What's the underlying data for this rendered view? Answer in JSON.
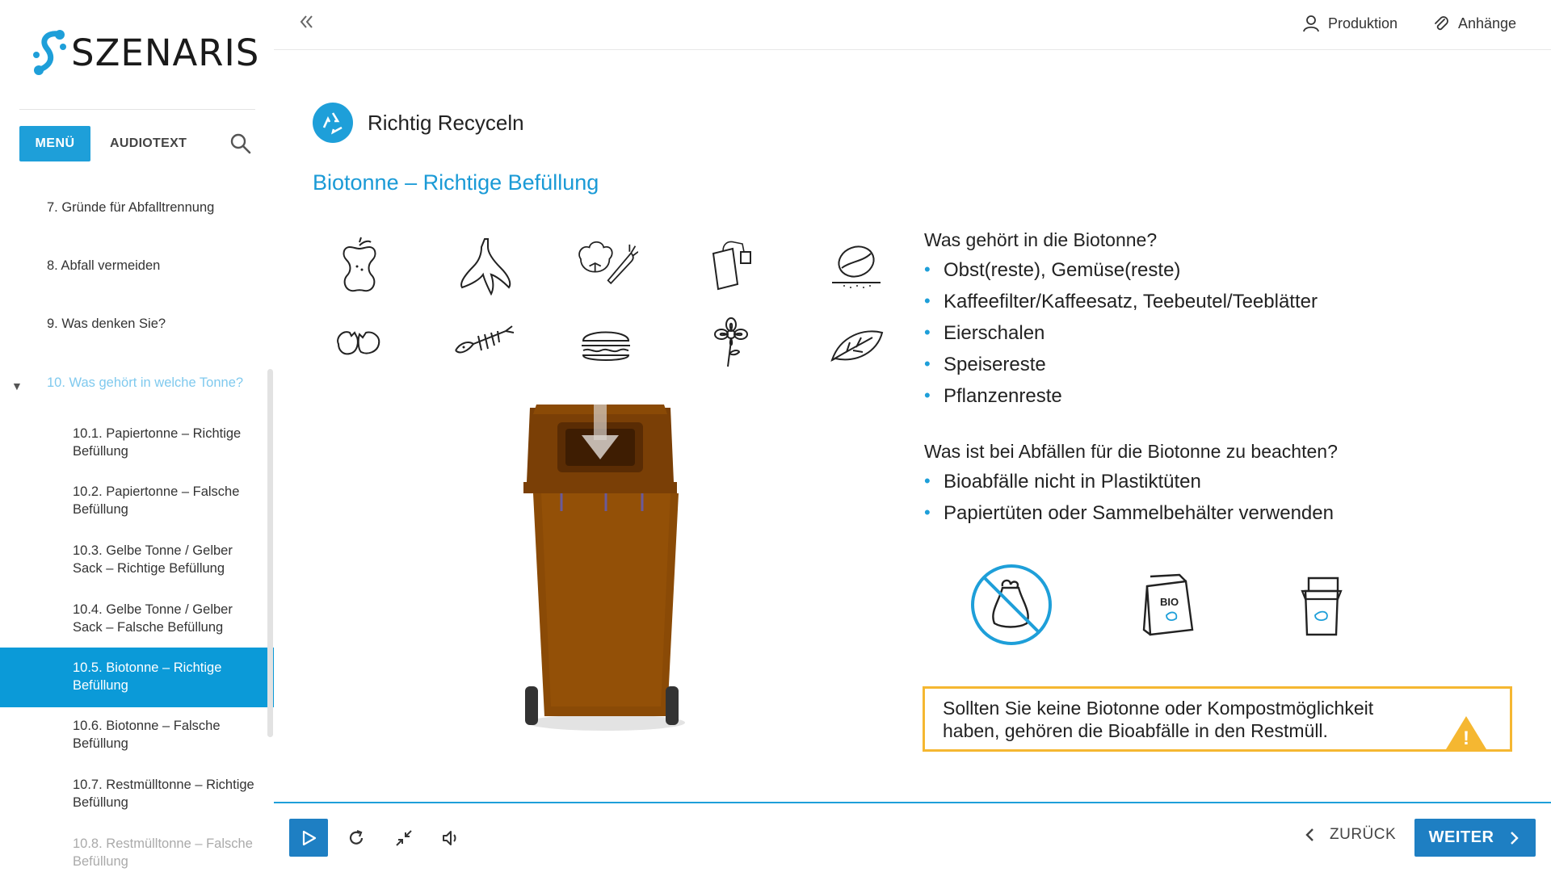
{
  "brand": {
    "name": "SZENARIS"
  },
  "sidebar": {
    "menu_label": "MENÜ",
    "audiotext_label": "AUDIOTEXT",
    "items": [
      {
        "label": "7. Gründe für Abfalltrennung"
      },
      {
        "label": "8. Abfall vermeiden"
      },
      {
        "label": "9. Was denken Sie?"
      },
      {
        "label": "10. Was gehört in welche Tonne?"
      },
      {
        "label": "10.1. Papiertonne – Richtige Befüllung"
      },
      {
        "label": "10.2. Papiertonne – Falsche Befüllung"
      },
      {
        "label": "10.3. Gelbe Tonne / Gelber Sack – Richtige Befüllung"
      },
      {
        "label": "10.4. Gelbe Tonne / Gelber Sack – Falsche Befüllung"
      },
      {
        "label": "10.5. Biotonne – Richtige Befüllung"
      },
      {
        "label": "10.6. Biotonne – Falsche Befüllung"
      },
      {
        "label": "10.7. Restmülltonne – Richtige Befüllung"
      },
      {
        "label": "10.8. Restmülltonne – Falsche Befüllung"
      }
    ]
  },
  "header": {
    "profile_label": "Produktion",
    "attachments_label": "Anhänge"
  },
  "main": {
    "course_title": "Richtig Recyceln",
    "page_heading": "Biotonne – Richtige Befüllung",
    "question1": "Was gehört in die Biotonne?",
    "list1": [
      "Obst(reste), Gemüse(reste)",
      "Kaffeefilter/Kaffeesatz, Teebeutel/Teeblätter",
      "Eierschalen",
      "Speisereste",
      "Pflanzenreste"
    ],
    "question2": "Was ist bei Abfällen für die Biotonne zu beachten?",
    "list2": [
      "Bioabfälle nicht in Plastiktüten",
      "Papiertüten oder Sammelbehälter verwenden"
    ],
    "bag_label": "BIO",
    "note_line1": "Sollten Sie keine Biotonne oder Kompostmöglichkeit",
    "note_line2": "haben, gehören die Bioabfälle in den Restmüll.",
    "warning_symbol": "!",
    "waste_icons": [
      "apple-core",
      "banana-peel",
      "vegetables",
      "tea-bag",
      "coffee-bean",
      "eggshell",
      "fish-bone",
      "burger",
      "flower",
      "leaf"
    ]
  },
  "footer": {
    "back_label": "ZURÜCK",
    "next_label": "WEITER"
  },
  "colors": {
    "accent": "#1e9fd9",
    "button": "#1e7fc3",
    "bin_brown": "#8a4a06",
    "warning": "#f5b731"
  }
}
